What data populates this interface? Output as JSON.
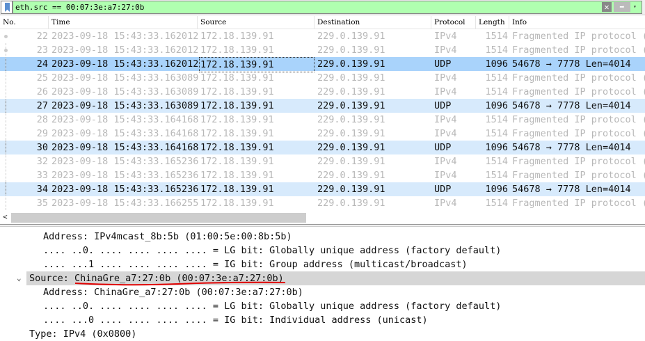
{
  "filter": {
    "value": "eth.src == 00:07:3e:a7:27:0b",
    "clear_icon": "✕",
    "apply_icon": "➡",
    "history_icon": "▾",
    "bookmark_icon": "bookmark-icon"
  },
  "columns": [
    "No.",
    "Time",
    "Source",
    "Destination",
    "Protocol",
    "Length",
    "Info"
  ],
  "rows": [
    {
      "no": "22",
      "time": "2023-09-18 15:43:33.162012",
      "src": "172.18.139.91",
      "dst": "229.0.139.91",
      "proto": "IPv4",
      "len": "1514",
      "info": "Fragmented IP protocol (",
      "type": "frag"
    },
    {
      "no": "23",
      "time": "2023-09-18 15:43:33.162012",
      "src": "172.18.139.91",
      "dst": "229.0.139.91",
      "proto": "IPv4",
      "len": "1514",
      "info": "Fragmented IP protocol (",
      "type": "frag"
    },
    {
      "no": "24",
      "time": "2023-09-18 15:43:33.162012",
      "src": "172.18.139.91",
      "dst": "229.0.139.91",
      "proto": "UDP",
      "len": "1096",
      "info": "54678 → 7778 Len=4014",
      "type": "selected"
    },
    {
      "no": "25",
      "time": "2023-09-18 15:43:33.163089",
      "src": "172.18.139.91",
      "dst": "229.0.139.91",
      "proto": "IPv4",
      "len": "1514",
      "info": "Fragmented IP protocol (",
      "type": "frag"
    },
    {
      "no": "26",
      "time": "2023-09-18 15:43:33.163089",
      "src": "172.18.139.91",
      "dst": "229.0.139.91",
      "proto": "IPv4",
      "len": "1514",
      "info": "Fragmented IP protocol (",
      "type": "frag"
    },
    {
      "no": "27",
      "time": "2023-09-18 15:43:33.163089",
      "src": "172.18.139.91",
      "dst": "229.0.139.91",
      "proto": "UDP",
      "len": "1096",
      "info": "54678 → 7778 Len=4014",
      "type": "udp"
    },
    {
      "no": "28",
      "time": "2023-09-18 15:43:33.164168",
      "src": "172.18.139.91",
      "dst": "229.0.139.91",
      "proto": "IPv4",
      "len": "1514",
      "info": "Fragmented IP protocol (",
      "type": "frag"
    },
    {
      "no": "29",
      "time": "2023-09-18 15:43:33.164168",
      "src": "172.18.139.91",
      "dst": "229.0.139.91",
      "proto": "IPv4",
      "len": "1514",
      "info": "Fragmented IP protocol (",
      "type": "frag"
    },
    {
      "no": "30",
      "time": "2023-09-18 15:43:33.164168",
      "src": "172.18.139.91",
      "dst": "229.0.139.91",
      "proto": "UDP",
      "len": "1096",
      "info": "54678 → 7778 Len=4014",
      "type": "udp"
    },
    {
      "no": "32",
      "time": "2023-09-18 15:43:33.165236",
      "src": "172.18.139.91",
      "dst": "229.0.139.91",
      "proto": "IPv4",
      "len": "1514",
      "info": "Fragmented IP protocol (",
      "type": "frag"
    },
    {
      "no": "33",
      "time": "2023-09-18 15:43:33.165236",
      "src": "172.18.139.91",
      "dst": "229.0.139.91",
      "proto": "IPv4",
      "len": "1514",
      "info": "Fragmented IP protocol (",
      "type": "frag"
    },
    {
      "no": "34",
      "time": "2023-09-18 15:43:33.165236",
      "src": "172.18.139.91",
      "dst": "229.0.139.91",
      "proto": "UDP",
      "len": "1096",
      "info": "54678 → 7778 Len=4014",
      "type": "udp"
    },
    {
      "no": "35",
      "time": "2023-09-18 15:43:33.166255",
      "src": "172.18.139.91",
      "dst": "229.0.139.91",
      "proto": "IPv4",
      "len": "1514",
      "info": "Fragmented IP protocol (",
      "type": "frag"
    }
  ],
  "details": [
    {
      "text": "Address: IPv4mcast_8b:5b (01:00:5e:00:8b:5b)",
      "indent": 2
    },
    {
      "text": ".... ..0. .... .... .... .... = LG bit: Globally unique address (factory default)",
      "indent": 2
    },
    {
      "text": ".... ...1 .... .... .... .... = IG bit: Group address (multicast/broadcast)",
      "indent": 2
    },
    {
      "text": "Source: ChinaGre_a7:27:0b (00:07:3e:a7:27:0b)",
      "indent": 1,
      "selected": true,
      "expanded": true
    },
    {
      "text": "Address: ChinaGre_a7:27:0b (00:07:3e:a7:27:0b)",
      "indent": 2
    },
    {
      "text": ".... ..0. .... .... .... .... = LG bit: Globally unique address (factory default)",
      "indent": 2
    },
    {
      "text": ".... ...0 .... .... .... .... = IG bit: Individual address (unicast)",
      "indent": 2
    },
    {
      "text": "Type: IPv4 (0x0800)",
      "indent": 1
    }
  ],
  "colors": {
    "filter_ok": "#b0ffb0",
    "selected_row": "#a9d3fb",
    "udp_row": "#d7eafc",
    "annotation": "#e00000"
  }
}
